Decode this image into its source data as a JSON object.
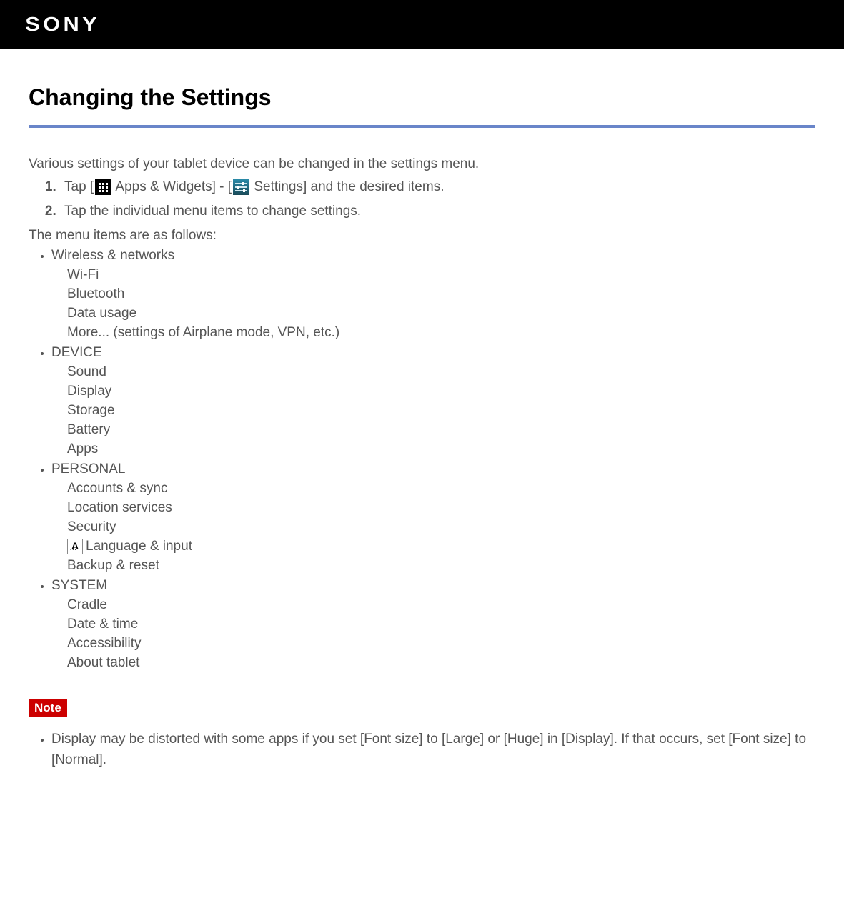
{
  "brand": "SONY",
  "title": "Changing the Settings",
  "intro": "Various settings of your tablet device can be changed in the settings menu.",
  "steps": {
    "s1a": "Tap [",
    "s1b": " Apps & Widgets] - [",
    "s1c": " Settings] and the desired items.",
    "s2": "Tap the individual menu items to change settings."
  },
  "menu_intro": "The menu items are as follows:",
  "groups": [
    {
      "title": "Wireless & networks",
      "items": [
        "Wi-Fi",
        "Bluetooth",
        "Data usage",
        "More... (settings of Airplane mode, VPN, etc.)"
      ]
    },
    {
      "title": "DEVICE",
      "items": [
        "Sound",
        "Display",
        "Storage",
        "Battery",
        "Apps"
      ]
    },
    {
      "title": "PERSONAL",
      "items": [
        "Accounts & sync",
        "Location services",
        "Security",
        "Language & input",
        "Backup & reset"
      ]
    },
    {
      "title": "SYSTEM",
      "items": [
        "Cradle",
        "Date & time",
        "Accessibility",
        "About tablet"
      ]
    }
  ],
  "note_label": "Note",
  "note_text": "Display may be distorted with some apps if you set [Font size] to [Large] or [Huge] in [Display]. If that occurs, set [Font size] to [Normal]."
}
